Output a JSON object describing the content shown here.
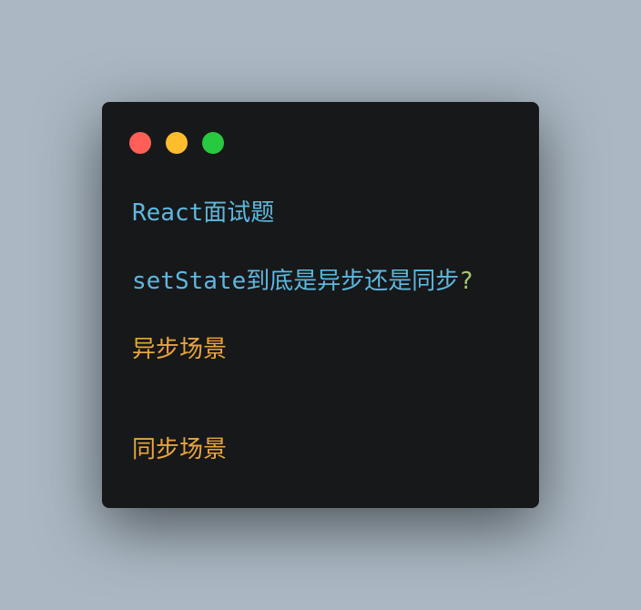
{
  "window": {
    "controls": [
      "close",
      "minimize",
      "zoom"
    ],
    "colors": {
      "background": "#abb8c3",
      "window": "#171819",
      "close": "#ff5f56",
      "minimize": "#ffbd2e",
      "zoom": "#27c93f",
      "text_blue": "#5db8e0",
      "text_green": "#a8c66c",
      "text_orange": "#e9a53c"
    }
  },
  "code": {
    "title": "React面试题",
    "question_text": "setState到底是异步还是同步",
    "question_mark": "?",
    "scenario_async": "异步场景",
    "scenario_sync": "同步场景"
  }
}
